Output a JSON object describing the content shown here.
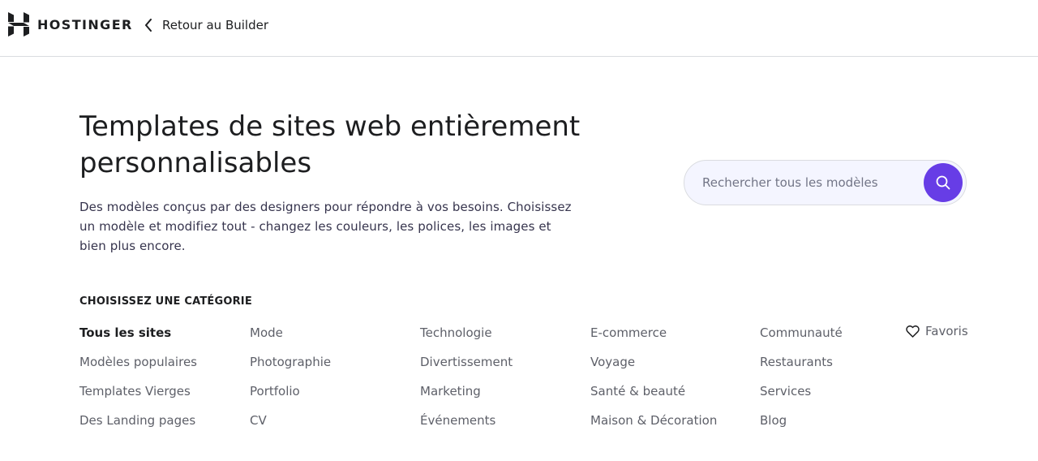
{
  "header": {
    "brand": "HOSTINGER",
    "back_label": "Retour au Builder"
  },
  "hero": {
    "title_line1": "Templates de sites web entièrement",
    "title_line2": "personnalisables",
    "description_line1": "Des modèles conçus par des designers pour répondre à vos besoins. Choisissez",
    "description_line2": "un modèle et modifiez tout - changez les couleurs, les polices, les images et",
    "description_line3": "bien plus encore."
  },
  "search": {
    "placeholder": "Rechercher tous les modèles",
    "value": ""
  },
  "categories": {
    "heading": "CHOISISSEZ UNE CATÉGORIE",
    "columns": [
      [
        "Tous les sites",
        "Modèles populaires",
        "Templates Vierges",
        "Des Landing pages"
      ],
      [
        "Mode",
        "Photographie",
        "Portfolio",
        "CV"
      ],
      [
        "Technologie",
        "Divertissement",
        "Marketing",
        "Événements"
      ],
      [
        "E-commerce",
        "Voyage",
        "Santé & beauté",
        "Maison & Décoration"
      ],
      [
        "Communauté",
        "Restaurants",
        "Services",
        "Blog"
      ]
    ],
    "active": "Tous les sites",
    "favorites_label": "Favoris"
  },
  "icons": {
    "logo": "hostinger-logo-icon",
    "back": "chevron-left-icon",
    "search": "search-icon",
    "favorites": "heart-icon"
  },
  "colors": {
    "accent": "#673de6",
    "text_primary": "#1d1e20",
    "text_secondary": "#5e6069",
    "search_bg": "#f4f5ff",
    "divider": "#dadce0"
  }
}
